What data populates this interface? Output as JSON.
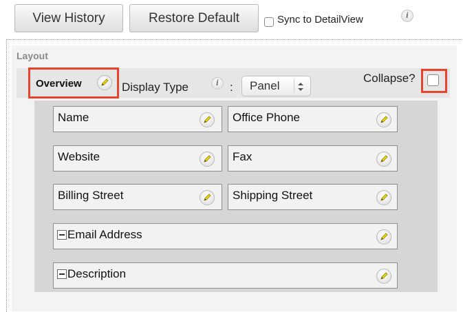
{
  "toolbar": {
    "view_history_label": "View History",
    "restore_default_label": "Restore Default",
    "sync_label": "Sync to DetailView",
    "sync_checked": false
  },
  "layout": {
    "label": "Layout",
    "panel": {
      "name": "Overview",
      "display_type_label": "Display Type",
      "colon": ":",
      "display_type_value": "Panel",
      "collapse_label": "Collapse?",
      "collapse_checked": false
    },
    "rows": [
      {
        "fields": [
          "Name",
          "Office Phone"
        ]
      },
      {
        "fields": [
          "Website",
          "Fax"
        ]
      },
      {
        "fields": [
          "Billing Street",
          "Shipping Street"
        ]
      },
      {
        "fields": [
          "Email Address"
        ]
      },
      {
        "fields": [
          "Description"
        ]
      }
    ]
  },
  "colors": {
    "highlight": "#e8412c",
    "layout_bg": "#f3f3f3",
    "panel_body_bg": "#d6d6d6"
  },
  "icons": {
    "info": "info-icon",
    "edit": "pencil-icon",
    "collapse_field": "minus-icon",
    "select_arrows": "up-down-arrows-icon"
  }
}
